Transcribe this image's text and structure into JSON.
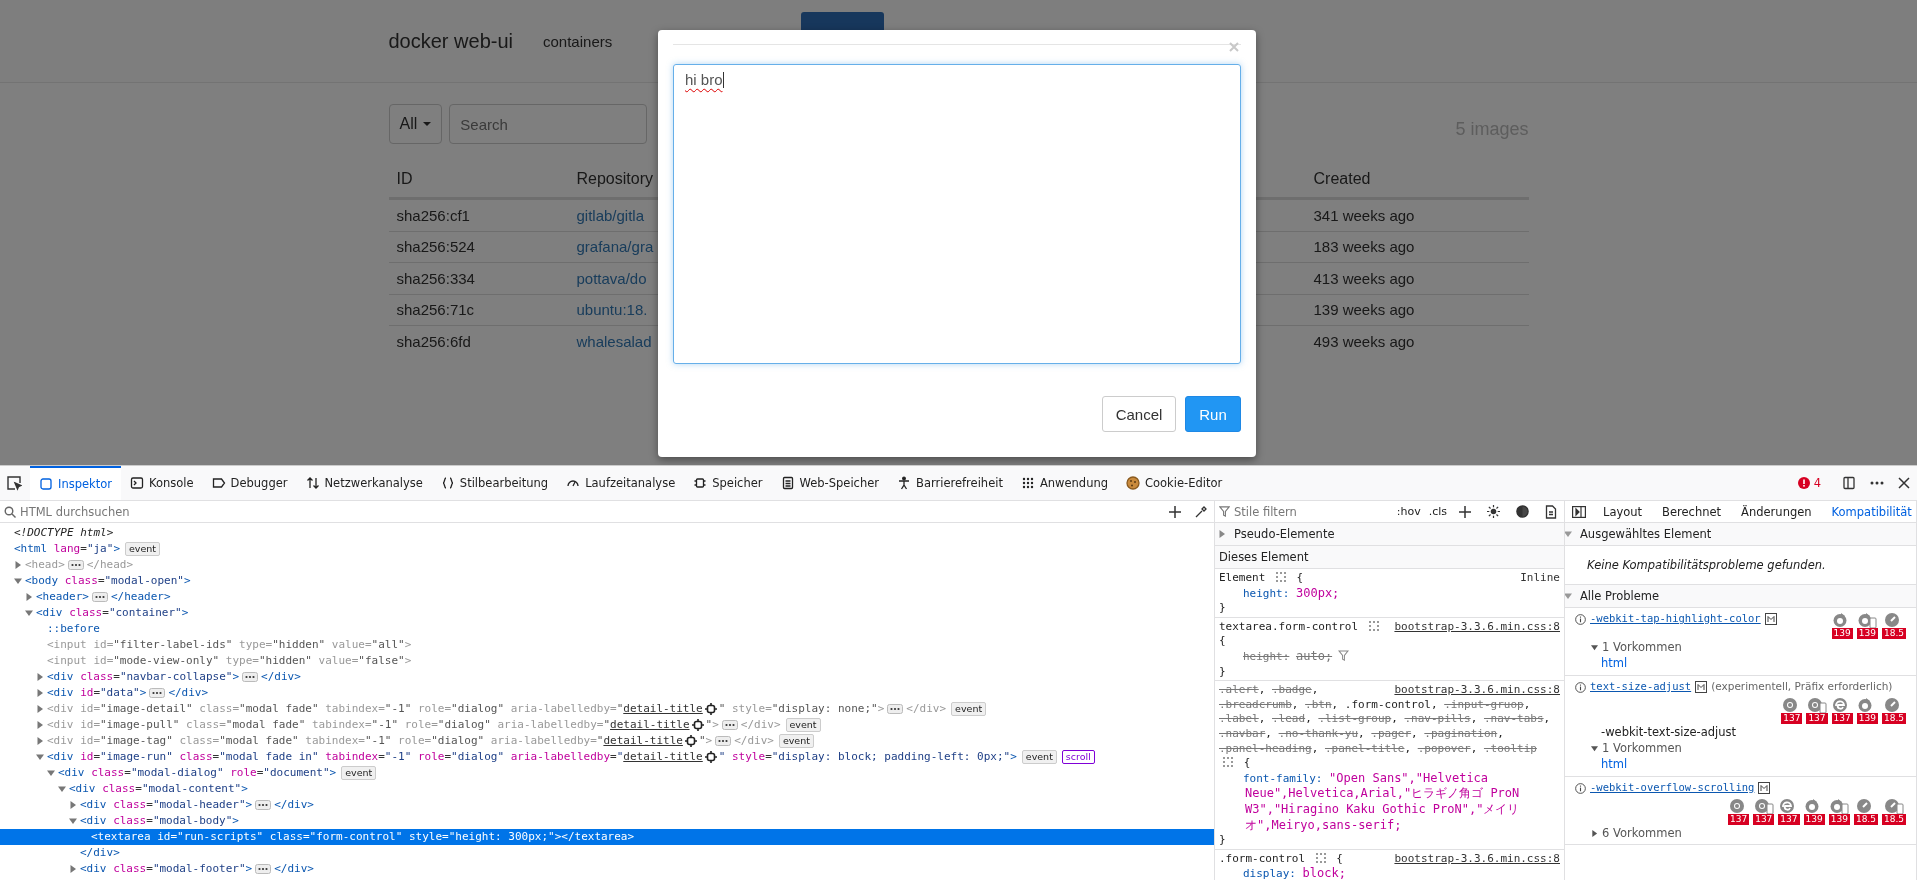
{
  "page": {
    "brand": "docker web-ui",
    "nav": [
      {
        "label": "containers",
        "selected": false
      },
      {
        "selected": true
      }
    ],
    "filter": {
      "label": "All"
    },
    "search": {
      "placeholder": "Search"
    },
    "count": "5 images",
    "table": {
      "columns": [
        "ID",
        "Repository",
        "Created"
      ],
      "rows": [
        {
          "id": "sha256:cf1",
          "repository": "gitlab/gitla",
          "created": "341 weeks ago"
        },
        {
          "id": "sha256:524",
          "repository": "grafana/gra",
          "created": "183 weeks ago"
        },
        {
          "id": "sha256:334",
          "repository": "pottava/do",
          "created": "413 weeks ago"
        },
        {
          "id": "sha256:71c",
          "repository": "ubuntu:18.",
          "created": "139 weeks ago"
        },
        {
          "id": "sha256:6fd",
          "repository": "whalesalad",
          "created": "493 weeks ago"
        }
      ]
    }
  },
  "modal": {
    "script": {
      "value": "hi bro"
    },
    "buttons": [
      {
        "label": "Cancel",
        "kind": "default"
      },
      {
        "label": "Run",
        "kind": "primary"
      }
    ]
  },
  "devtools": {
    "tabs": [
      {
        "label": "Inspektor",
        "kind": "inspector",
        "selected": true
      },
      {
        "label": "Konsole",
        "kind": "console",
        "selected": false
      },
      {
        "label": "Debugger",
        "kind": "debugger",
        "selected": false
      },
      {
        "label": "Netzwerkanalyse",
        "kind": "network",
        "selected": false
      },
      {
        "label": "Stilbearbeitung",
        "kind": "style",
        "selected": false
      },
      {
        "label": "Laufzeitanalyse",
        "kind": "performance",
        "selected": false
      },
      {
        "label": "Speicher",
        "kind": "memory",
        "selected": false
      },
      {
        "label": "Web-Speicher",
        "kind": "storage",
        "selected": false
      },
      {
        "label": "Barrierefreiheit",
        "kind": "accessibility",
        "selected": false
      },
      {
        "label": "Anwendung",
        "kind": "application",
        "selected": false
      },
      {
        "label": "Cookie-Editor",
        "kind": "cookie",
        "selected": false
      }
    ],
    "error_count": "4"
  },
  "inspector": {
    "search": {
      "placeholder": "HTML durchsuchen"
    },
    "tree": [
      {
        "kind": "doctype",
        "selected": false,
        "parts": [
          {
            "kind": "code",
            "text": "<!DOCTYPE html>"
          }
        ]
      },
      {
        "kind": "element",
        "selected": false,
        "parts": [
          {
            "kind": "code",
            "text": "<html lang=\"ja\">"
          },
          {
            "kind": "badge",
            "text": "event"
          }
        ],
        "children": [
          {
            "kind": "element",
            "selected": false,
            "dimmed": true,
            "expanded": false,
            "parts": [
              {
                "kind": "code",
                "text": "<head>"
              },
              {
                "kind": "more"
              },
              {
                "kind": "code",
                "text": "</head>"
              }
            ]
          },
          {
            "kind": "element",
            "selected": false,
            "expanded": true,
            "parts": [
              {
                "kind": "code",
                "text": "<body class=\"modal-open\">"
              }
            ],
            "children": [
              {
                "kind": "element",
                "selected": false,
                "expanded": false,
                "parts": [
                  {
                    "kind": "code",
                    "text": "<header>"
                  },
                  {
                    "kind": "more"
                  },
                  {
                    "kind": "code",
                    "text": "</header>"
                  }
                ]
              },
              {
                "kind": "element",
                "selected": false,
                "expanded": true,
                "parts": [
                  {
                    "kind": "code",
                    "text": "<div class=\"container\">"
                  }
                ],
                "children": [
                  {
                    "kind": "pseudo",
                    "selected": false,
                    "parts": [
                      {
                        "kind": "code",
                        "text": "::before"
                      }
                    ]
                  },
                  {
                    "kind": "element",
                    "selected": false,
                    "dimmed": true,
                    "parts": [
                      {
                        "kind": "code",
                        "text": "<input id=\"filter-label-ids\" type=\"hidden\" value=\"all\">"
                      }
                    ]
                  },
                  {
                    "kind": "element",
                    "selected": false,
                    "dimmed": true,
                    "parts": [
                      {
                        "kind": "code",
                        "text": "<input id=\"mode-view-only\" type=\"hidden\" value=\"false\">"
                      }
                    ]
                  },
                  {
                    "kind": "element",
                    "selected": false,
                    "expanded": false,
                    "parts": [
                      {
                        "kind": "code",
                        "text": "<div class=\"navbar-collapse\">"
                      },
                      {
                        "kind": "more"
                      },
                      {
                        "kind": "code",
                        "text": "</div>"
                      }
                    ]
                  },
                  {
                    "kind": "element",
                    "selected": false,
                    "expanded": false,
                    "parts": [
                      {
                        "kind": "code",
                        "text": "<div id=\"data\">"
                      },
                      {
                        "kind": "more"
                      },
                      {
                        "kind": "code",
                        "text": "</div>"
                      }
                    ]
                  },
                  {
                    "kind": "element",
                    "selected": false,
                    "dimmed": true,
                    "expanded": false,
                    "parts": [
                      {
                        "kind": "code",
                        "text": "<div id=\"image-detail\" class=\"modal fade\" tabindex=\"-1\" role=\"dialog\" aria-labelledby=\""
                      },
                      {
                        "kind": "link",
                        "text": "detail-title"
                      },
                      {
                        "kind": "code",
                        "text": "\" style=\"display: none;\">"
                      },
                      {
                        "kind": "more"
                      },
                      {
                        "kind": "code",
                        "text": "</div>"
                      },
                      {
                        "kind": "badge",
                        "text": "event"
                      }
                    ]
                  },
                  {
                    "kind": "element",
                    "selected": false,
                    "dimmed": true,
                    "expanded": false,
                    "parts": [
                      {
                        "kind": "code",
                        "text": "<div id=\"image-pull\" class=\"modal fade\" tabindex=\"-1\" role=\"dialog\" aria-labelledby=\""
                      },
                      {
                        "kind": "link",
                        "text": "detail-title"
                      },
                      {
                        "kind": "code",
                        "text": "\">"
                      },
                      {
                        "kind": "more"
                      },
                      {
                        "kind": "code",
                        "text": "</div>"
                      },
                      {
                        "kind": "badge",
                        "text": "event"
                      }
                    ]
                  },
                  {
                    "kind": "element",
                    "selected": false,
                    "dimmed": true,
                    "expanded": false,
                    "parts": [
                      {
                        "kind": "code",
                        "text": "<div id=\"image-tag\" class=\"modal fade\" tabindex=\"-1\" role=\"dialog\" aria-labelledby=\""
                      },
                      {
                        "kind": "link",
                        "text": "detail-title"
                      },
                      {
                        "kind": "code",
                        "text": "\">"
                      },
                      {
                        "kind": "more"
                      },
                      {
                        "kind": "code",
                        "text": "</div>"
                      },
                      {
                        "kind": "badge",
                        "text": "event"
                      }
                    ]
                  },
                  {
                    "kind": "element",
                    "selected": false,
                    "expanded": true,
                    "parts": [
                      {
                        "kind": "code",
                        "text": "<div id=\"image-run\" class=\"modal fade in\" tabindex=\"-1\" role=\"dialog\" aria-labelledby=\""
                      },
                      {
                        "kind": "link",
                        "text": "detail-title"
                      },
                      {
                        "kind": "code",
                        "text": "\" style=\"display: block; padding-left: 0px;\">"
                      },
                      {
                        "kind": "badge",
                        "text": "event"
                      },
                      {
                        "kind": "flag",
                        "text": "scroll"
                      }
                    ],
                    "children": [
                      {
                        "kind": "element",
                        "selected": false,
                        "expanded": true,
                        "parts": [
                          {
                            "kind": "code",
                            "text": "<div class=\"modal-dialog\" role=\"document\">"
                          },
                          {
                            "kind": "badge",
                            "text": "event"
                          }
                        ],
                        "children": [
                          {
                            "kind": "element",
                            "selected": false,
                            "expanded": true,
                            "parts": [
                              {
                                "kind": "code",
                                "text": "<div class=\"modal-content\">"
                              }
                            ],
                            "children": [
                              {
                                "kind": "element",
                                "selected": false,
                                "expanded": false,
                                "parts": [
                                  {
                                    "kind": "code",
                                    "text": "<div class=\"modal-header\">"
                                  },
                                  {
                                    "kind": "more"
                                  },
                                  {
                                    "kind": "code",
                                    "text": "</div>"
                                  }
                                ]
                              },
                              {
                                "kind": "element",
                                "selected": false,
                                "expanded": true,
                                "closing": "</div>",
                                "parts": [
                                  {
                                    "kind": "code",
                                    "text": "<div class=\"modal-body\">"
                                  }
                                ],
                                "children": [
                                  {
                                    "kind": "element",
                                    "selected": true,
                                    "parts": [
                                      {
                                        "kind": "code",
                                        "text": "<textarea id=\"run-scripts\" class=\"form-control\" style=\"height: 300px;\"></textarea>"
                                      }
                                    ]
                                  }
                                ]
                              },
                              {
                                "kind": "element",
                                "selected": false,
                                "expanded": false,
                                "parts": [
                                  {
                                    "kind": "code",
                                    "text": "<div class=\"modal-footer\">"
                                  },
                                  {
                                    "kind": "more"
                                  },
                                  {
                                    "kind": "code",
                                    "text": "</div>"
                                  }
                                ]
                              }
                            ]
                          }
                        ]
                      }
                    ]
                  }
                ]
              }
            ]
          }
        ]
      }
    ]
  },
  "styles": {
    "filter": {
      "placeholder": "Stile filtern"
    },
    "toggles": [
      ":hov",
      ".cls"
    ],
    "pseudo": {
      "label": "Pseudo-Elemente",
      "expanded": false
    },
    "heading": "Dieses Element",
    "rules": [
      {
        "selectors": [
          {
            "text": "Element",
            "matched": true
          }
        ],
        "source": "Inline",
        "source_is_link": false,
        "brace_on_new_line": false,
        "open": "{",
        "close": "}",
        "declarations": [
          {
            "property": "height:",
            "value": "300px;",
            "overridden": false
          }
        ]
      },
      {
        "selectors": [
          {
            "text": "textarea.form-control",
            "matched": true
          }
        ],
        "source": "bootstrap-3.3.6.min.css:8",
        "source_is_link": true,
        "brace_on_new_line": true,
        "open": "{",
        "close": "}",
        "declarations": [
          {
            "property": "height:",
            "value": "auto;",
            "overridden": true
          }
        ]
      },
      {
        "separator": ",",
        "selectors": [
          {
            "text": ".alert",
            "matched": false
          },
          {
            "text": ".badge",
            "matched": false
          },
          {
            "text": ".breadcrumb",
            "matched": false
          },
          {
            "text": ".btn",
            "matched": false
          },
          {
            "text": ".form-control",
            "matched": true
          },
          {
            "text": ".input-gruop",
            "matched": false
          },
          {
            "text": ".label",
            "matched": false
          },
          {
            "text": ".lead",
            "matched": false
          },
          {
            "text": ".list-group",
            "matched": false
          },
          {
            "text": ".nav-pills",
            "matched": false
          },
          {
            "text": ".nav-tabs",
            "matched": false
          },
          {
            "text": ".navbar",
            "matched": false
          },
          {
            "text": ".no-thank-yu",
            "matched": false
          },
          {
            "text": ".pager",
            "matched": false
          },
          {
            "text": ".pagination",
            "matched": false
          },
          {
            "text": ".panel-heading",
            "matched": false
          },
          {
            "text": ".panel-title",
            "matched": false
          },
          {
            "text": ".popover",
            "matched": false
          },
          {
            "text": ".tooltip",
            "matched": false
          }
        ],
        "source": "bootstrap-3.3.6.min.css:8",
        "source_is_link": true,
        "brace_on_new_line": false,
        "open": "{",
        "close": "}",
        "declarations": [
          {
            "property": "font-family:",
            "value": "\"Open Sans\",\"Helvetica Neue\",Helvetica,Arial,\"ヒラギノ角ゴ ProN W3\",\"Hiragino Kaku Gothic ProN\",\"メイリオ\",Meiryo,sans-serif;",
            "overridden": false
          }
        ]
      },
      {
        "selectors": [
          {
            "text": ".form-control",
            "matched": true
          }
        ],
        "source": "bootstrap-3.3.6.min.css:8",
        "source_is_link": true,
        "brace_on_new_line": false,
        "open": "{",
        "declarations": [
          {
            "property": "display:",
            "value": "block;",
            "overridden": false
          }
        ]
      }
    ]
  },
  "compat": {
    "tabs": [
      {
        "label": "Layout",
        "selected": false
      },
      {
        "label": "Berechnet",
        "selected": false
      },
      {
        "label": "Änderungen",
        "selected": false
      },
      {
        "label": "Kompatibilität",
        "selected": true
      }
    ],
    "selected_section": {
      "title": "Ausgewähltes Element",
      "expanded": true,
      "message": "Keine Kompatibilitätsprobleme gefunden."
    },
    "all_section": {
      "title": "Alle Probleme",
      "expanded": true
    },
    "issues": [
      {
        "property": "-webkit-tap-highlight-color",
        "browsers": [
          {
            "kind": "firefox",
            "mobile": false,
            "version": "139"
          },
          {
            "kind": "firefox",
            "mobile": true,
            "version": "139"
          },
          {
            "kind": "safari",
            "mobile": false,
            "version": "18.5"
          }
        ],
        "occurrences": "1 Vorkommen",
        "expanded": true,
        "nodes": [
          "html"
        ]
      },
      {
        "property": "text-size-adjust",
        "note": "(experimentell, Präfix erforderlich)",
        "browsers": [
          {
            "kind": "chrome",
            "mobile": false,
            "version": "137"
          },
          {
            "kind": "chrome",
            "mobile": true,
            "version": "137"
          },
          {
            "kind": "edge",
            "mobile": false,
            "version": "137"
          },
          {
            "kind": "firefox",
            "mobile": false,
            "version": "139"
          },
          {
            "kind": "safari",
            "mobile": false,
            "version": "18.5"
          }
        ],
        "alias": "-webkit-text-size-adjust",
        "occurrences": "1 Vorkommen",
        "expanded": true,
        "nodes": [
          "html"
        ]
      },
      {
        "property": "-webkit-overflow-scrolling",
        "browsers": [
          {
            "kind": "chrome",
            "mobile": false,
            "version": "137"
          },
          {
            "kind": "chrome",
            "mobile": true,
            "version": "137"
          },
          {
            "kind": "edge",
            "mobile": false,
            "version": "137"
          },
          {
            "kind": "firefox",
            "mobile": false,
            "version": "139"
          },
          {
            "kind": "firefox",
            "mobile": true,
            "version": "139"
          },
          {
            "kind": "safari",
            "mobile": false,
            "version": "18.5"
          },
          {
            "kind": "safari",
            "mobile": true,
            "version": "18.5"
          }
        ],
        "occurrences": "6 Vorkommen",
        "expanded": false
      }
    ]
  }
}
